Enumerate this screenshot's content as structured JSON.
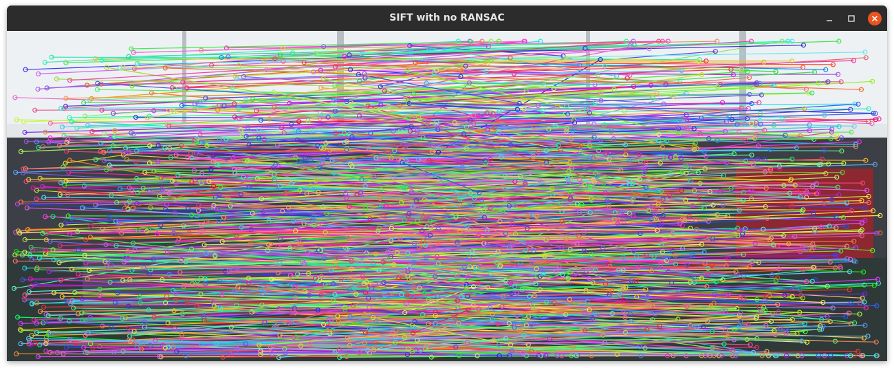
{
  "window": {
    "title": "SIFT with no RANSAC",
    "controls": {
      "minimize": "minimize-icon",
      "maximize": "maximize-icon",
      "close": "close-icon"
    },
    "close_color": "#e95420"
  },
  "image": {
    "description_icon": "feature-matches-image",
    "colors": {
      "window_bg": "#eef1f3",
      "wall": "#d9dde0",
      "frame": "#b9bec2",
      "floor": "#2f3a38",
      "furniture": "#3c3f45",
      "chair": "#8d2730"
    }
  }
}
